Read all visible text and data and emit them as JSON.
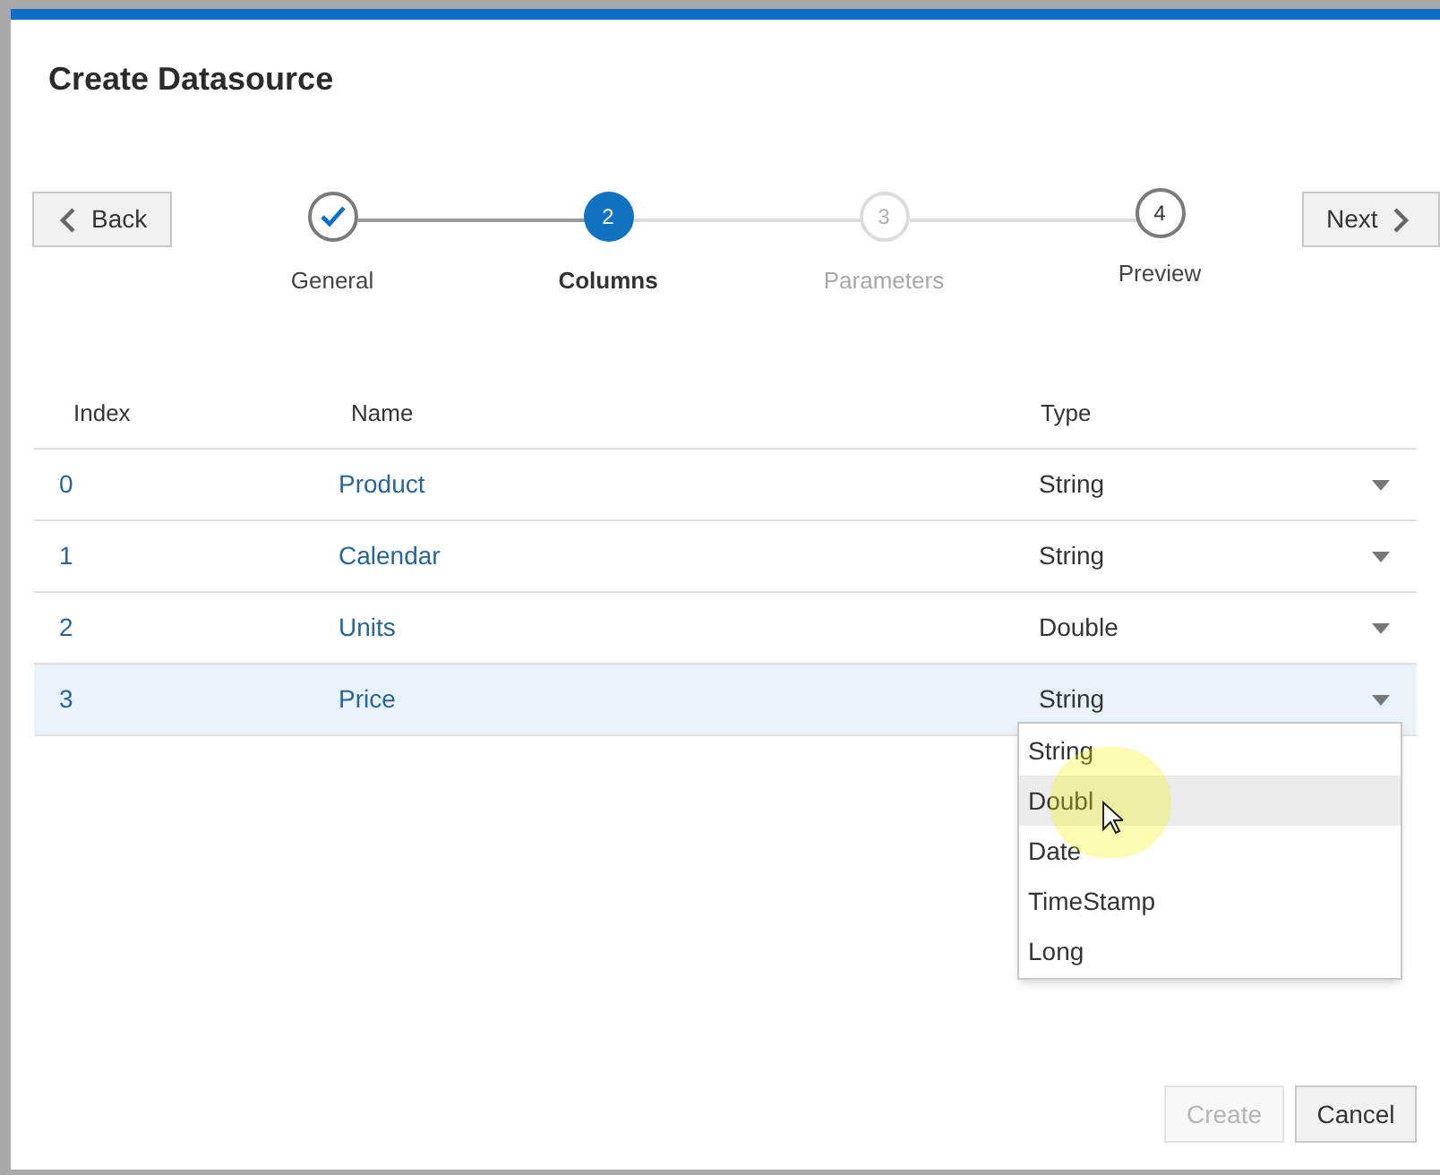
{
  "dialog": {
    "title": "Create Datasource"
  },
  "back_button": "Back",
  "next_button": "Next",
  "steps": [
    {
      "label": "General",
      "completed": true,
      "selected": false,
      "disabled": false
    },
    {
      "number": "2",
      "label": "Columns",
      "completed": false,
      "selected": true,
      "disabled": false
    },
    {
      "number": "3",
      "label": "Parameters",
      "completed": false,
      "selected": false,
      "disabled": true
    },
    {
      "number": "4",
      "label": "Preview",
      "completed": false,
      "selected": false,
      "disabled": false
    }
  ],
  "table": {
    "columns": [
      "Index",
      "Name",
      "Type"
    ],
    "rows": [
      {
        "index": "0",
        "name": "Product",
        "type": "String",
        "selected": false
      },
      {
        "index": "1",
        "name": "Calendar",
        "type": "String",
        "selected": false
      },
      {
        "index": "2",
        "name": "Units",
        "type": "Double",
        "selected": false
      },
      {
        "index": "3",
        "name": "Price",
        "type": "String",
        "selected": true
      }
    ]
  },
  "type_menu": {
    "items": [
      {
        "label": "String",
        "hovered": false
      },
      {
        "label": "Doubl",
        "hovered": true
      },
      {
        "label": "Date",
        "hovered": false
      },
      {
        "label": "TimeStamp",
        "hovered": false
      },
      {
        "label": "Long",
        "hovered": false
      }
    ]
  },
  "footer": {
    "create": {
      "label": "Create",
      "disabled": true
    },
    "cancel": {
      "label": "Cancel",
      "disabled": false
    }
  }
}
